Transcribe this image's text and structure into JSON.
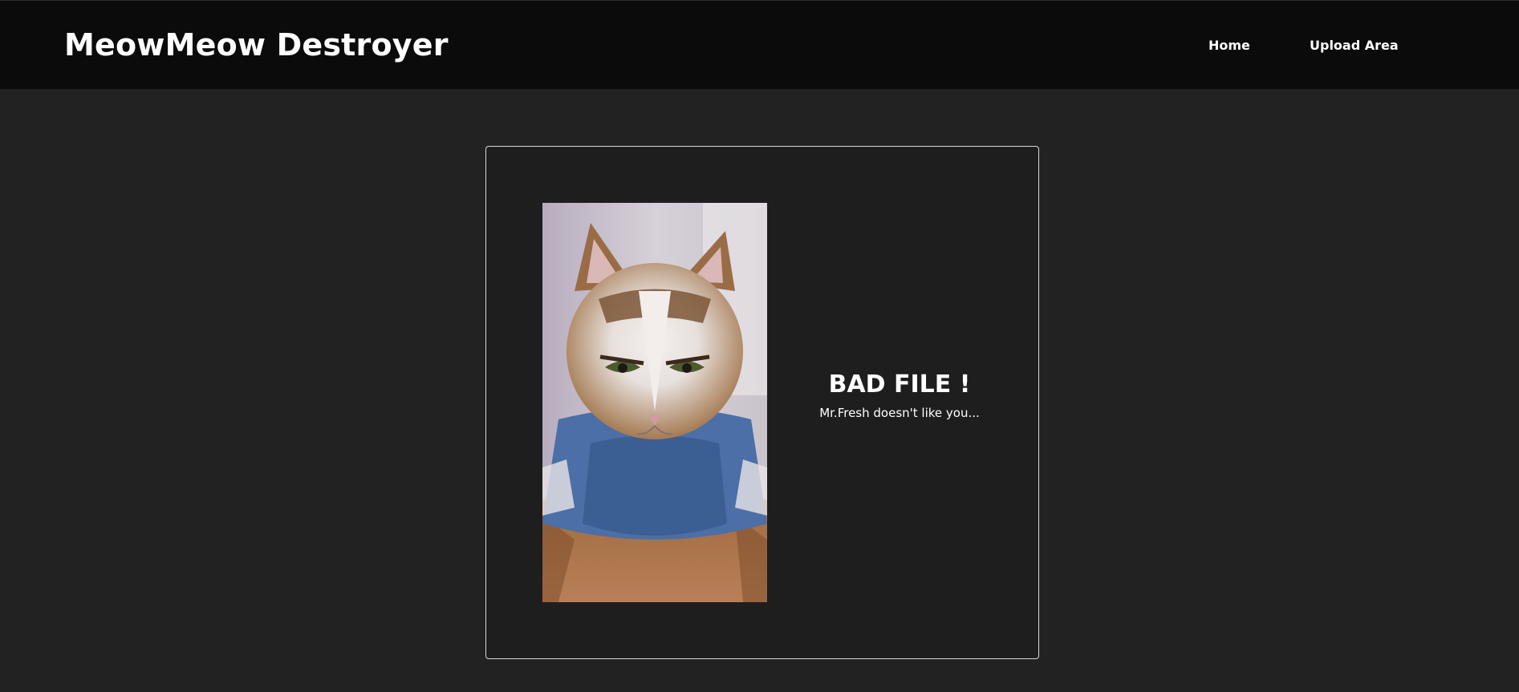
{
  "header": {
    "brand": "MeowMeow Destroyer",
    "nav": [
      {
        "label": "Home"
      },
      {
        "label": "Upload Area"
      }
    ]
  },
  "result": {
    "image_subject": "angry-cat-gif",
    "title": "BAD FILE !",
    "subtitle": "Mr.Fresh doesn't like you..."
  },
  "colors": {
    "page_background": "#222222",
    "navbar_background": "#0b0b0b",
    "card_background": "#1e1e1e",
    "card_border": "#d8d8d8",
    "text": "#ffffff"
  }
}
